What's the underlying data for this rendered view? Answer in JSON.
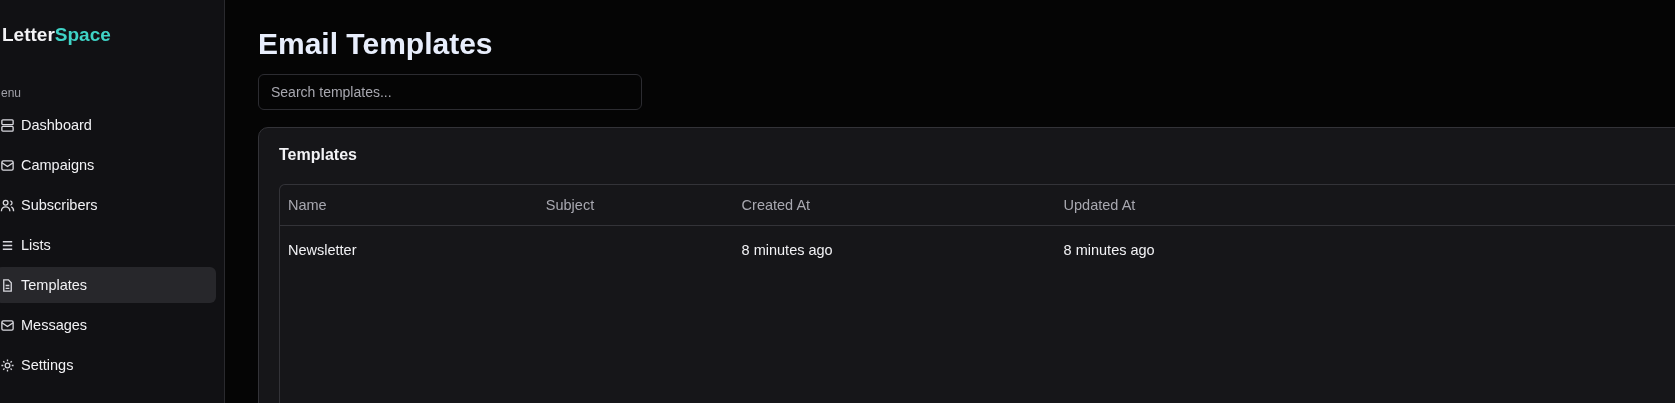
{
  "sidebar": {
    "logo": {
      "part_1": "Letter",
      "part_2": "Space"
    },
    "section_label": "enu",
    "items": [
      {
        "label": "Dashboard",
        "kind": "dashboard",
        "selected": false
      },
      {
        "label": "Campaigns",
        "kind": "mail",
        "selected": false
      },
      {
        "label": "Subscribers",
        "kind": "users",
        "selected": false
      },
      {
        "label": "Lists",
        "kind": "list",
        "selected": false
      },
      {
        "label": "Templates",
        "kind": "file",
        "selected": true
      },
      {
        "label": "Messages",
        "kind": "mail",
        "selected": false
      },
      {
        "label": "Settings",
        "kind": "gear",
        "selected": false
      }
    ]
  },
  "page_title": "Email Templates",
  "search": {
    "placeholder": "Search templates..."
  },
  "card": {
    "title": "Templates",
    "table": {
      "columns": [
        "Name",
        "Subject",
        "Created At",
        "Updated At"
      ],
      "rows": [
        [
          "Newsletter",
          "",
          "8 minutes ago",
          "8 minutes ago"
        ]
      ]
    }
  }
}
